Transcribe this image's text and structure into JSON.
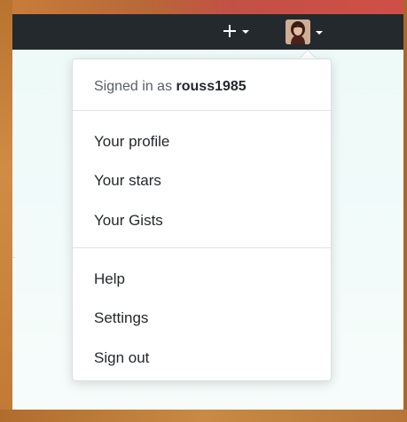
{
  "header": {
    "create_menu": {
      "icon": "plus-icon",
      "caret": "chevron-down-icon"
    },
    "user_menu": {
      "avatar": "avatar",
      "caret": "chevron-down-icon"
    },
    "background_color": "#24292e"
  },
  "dropdown": {
    "signed_in_prefix": "Signed in as",
    "username": "rouss1985",
    "items": [
      {
        "label": "Your profile"
      },
      {
        "label": "Your stars"
      },
      {
        "label": "Your Gists"
      },
      {
        "label": "Help"
      },
      {
        "label": "Settings"
      },
      {
        "label": "Sign out"
      }
    ]
  },
  "colors": {
    "text_primary": "#24292e",
    "text_secondary": "#586069",
    "divider": "#e1e4e8",
    "page_bg": "#edf9f8"
  }
}
